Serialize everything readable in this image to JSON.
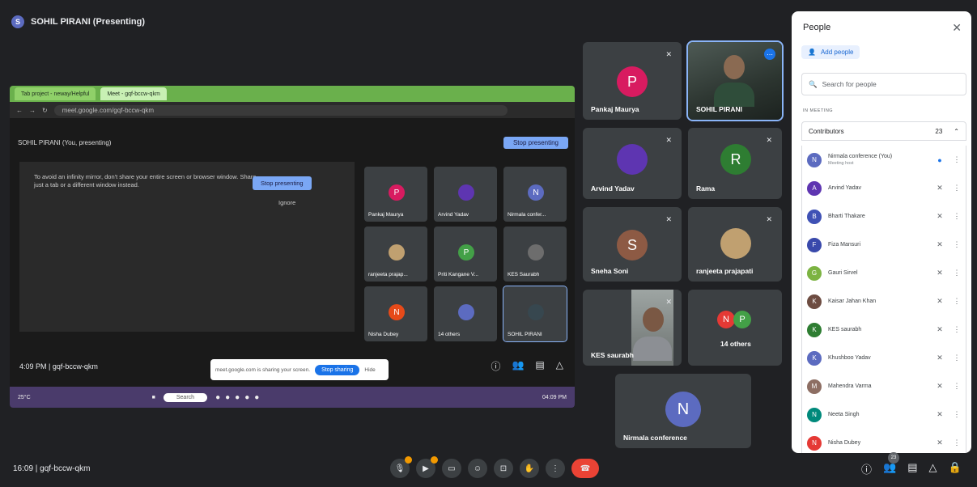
{
  "presenter": {
    "initial": "S",
    "label": "SOHIL PIRANI (Presenting)"
  },
  "shared_screen": {
    "tabs": [
      "Tab project - neway/Helpful",
      "Meet - gqf-bccw-qkm"
    ],
    "url": "meet.google.com/gqf-bccw-qkm",
    "presenting_label": "SOHIL PIRANI (You, presenting)",
    "stop_presenting": "Stop presenting",
    "mirror_message": "To avoid an infinity mirror, don't share your entire screen or browser window. Share just a tab or a different window instead.",
    "mirror_stop": "Stop presenting",
    "mirror_ignore": "Ignore",
    "time_code": "4:09 PM  |  gqf-bccw-qkm",
    "share_notice": "meet.google.com is sharing your screen.",
    "stop_sharing": "Stop sharing",
    "hide": "Hide",
    "taskbar_weather": "25°C",
    "taskbar_search": "Search",
    "taskbar_time": "04:09 PM",
    "inner_tiles": [
      {
        "name": "Pankaj Maurya",
        "initial": "P",
        "color": "#d81b60"
      },
      {
        "name": "Arvind Yadav",
        "initial": "",
        "color": "#5e35b1"
      },
      {
        "name": "Nirmala confer...",
        "initial": "N",
        "color": "#5c6bc0"
      },
      {
        "name": "ranjeeta prajap...",
        "initial": "",
        "color": "#c0a070"
      },
      {
        "name": "Priti Kangane V...",
        "initial": "P",
        "color": "#43a047"
      },
      {
        "name": "KES Saurabh",
        "initial": "",
        "color": "#6d6d6d"
      },
      {
        "name": "Nisha Dubey",
        "initial": "N",
        "color": "#e64a19"
      },
      {
        "name": "14 others",
        "initial": "",
        "color": "#5c6bc0"
      },
      {
        "name": "SOHIL PIRANI",
        "initial": "",
        "color": "#37474f"
      }
    ]
  },
  "tiles": {
    "pankaj": "Pankaj Maurya",
    "sohil": "SOHIL PIRANI",
    "arvind": "Arvind Yadav",
    "rama": "Rama",
    "sneha": "Sneha Soni",
    "ranjeeta": "ranjeeta prajapati",
    "kes": "KES saurabh",
    "others": "14 others",
    "nirmala": "Nirmala conference",
    "initials": {
      "pankaj": "P",
      "rama": "R",
      "sneha": "S",
      "nirmala": "N",
      "others_a": "N",
      "others_b": "P"
    }
  },
  "people": {
    "title": "People",
    "add_people": "Add people",
    "search_placeholder": "Search for people",
    "in_meeting": "IN MEETING",
    "contributors": "Contributors",
    "contributors_count": "23",
    "list": [
      {
        "name": "Nirmala conference (You)",
        "sub": "Meeting host",
        "initial": "N",
        "color": "#5c6bc0",
        "host": true
      },
      {
        "name": "Arvind Yadav",
        "sub": "",
        "initial": "A",
        "color": "#5e35b1"
      },
      {
        "name": "Bharti Thakare",
        "sub": "",
        "initial": "B",
        "color": "#3f51b5"
      },
      {
        "name": "Fiza Mansuri",
        "sub": "",
        "initial": "F",
        "color": "#3949ab"
      },
      {
        "name": "Gauri Sirvel",
        "sub": "",
        "initial": "G",
        "color": "#7cb342"
      },
      {
        "name": "Kaisar Jahan Khan",
        "sub": "",
        "initial": "K",
        "color": "#6d4c41"
      },
      {
        "name": "KES saurabh",
        "sub": "",
        "initial": "K",
        "color": "#2e7d32"
      },
      {
        "name": "Khushboo Yadav",
        "sub": "",
        "initial": "K",
        "color": "#5c6bc0"
      },
      {
        "name": "Mahendra Varma",
        "sub": "",
        "initial": "M",
        "color": "#8d6e63"
      },
      {
        "name": "Neeta Singh",
        "sub": "",
        "initial": "N",
        "color": "#00897b"
      },
      {
        "name": "Nisha Dubey",
        "sub": "",
        "initial": "N",
        "color": "#e53935"
      }
    ]
  },
  "bottom": {
    "meeting_info": "16:09  |  gqf-bccw-qkm",
    "participant_count": "23"
  }
}
